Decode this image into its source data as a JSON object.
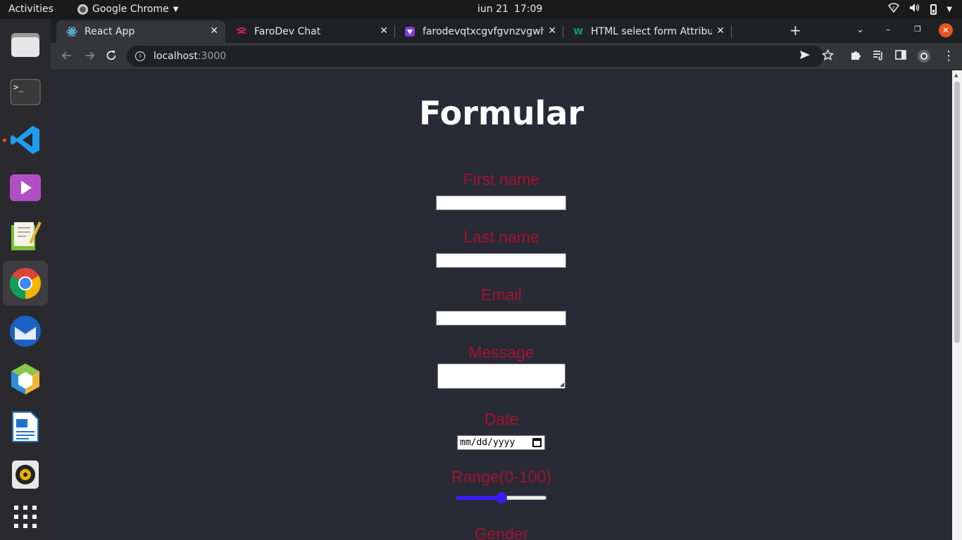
{
  "system": {
    "activities": "Activities",
    "app_name": "Google Chrome",
    "date": "iun 21",
    "time": "17:09"
  },
  "dock": {
    "items": [
      {
        "name": "files",
        "icon": "folder-icon"
      },
      {
        "name": "terminal",
        "icon": "terminal-icon"
      },
      {
        "name": "vscode",
        "icon": "vscode-icon"
      },
      {
        "name": "video",
        "icon": "play-icon"
      },
      {
        "name": "text-editor",
        "icon": "notepad-icon"
      },
      {
        "name": "chrome",
        "icon": "chrome-icon"
      },
      {
        "name": "thunderbird",
        "icon": "mail-icon"
      },
      {
        "name": "virtualbox",
        "icon": "cube-icon"
      },
      {
        "name": "writer",
        "icon": "document-icon"
      },
      {
        "name": "rhythmbox",
        "icon": "speaker-icon"
      },
      {
        "name": "app-grid",
        "icon": "grid-icon"
      }
    ]
  },
  "browser": {
    "tabs": [
      {
        "title": "React App",
        "active": true
      },
      {
        "title": "FaroDev Chat",
        "active": false
      },
      {
        "title": "farodevqtxcgvfgvnzvgwh",
        "active": false
      },
      {
        "title": "HTML select form Attribu",
        "active": false
      }
    ],
    "url_host": "localhost",
    "url_port": ":3000"
  },
  "form": {
    "title": "Formular",
    "first_name_label": "First name",
    "last_name_label": "Last name",
    "email_label": "Email",
    "message_label": "Message",
    "date_label": "Date",
    "date_placeholder": "mm/dd/yyyy",
    "range_label": "Range(0-100)",
    "range_value": 50,
    "range_min": 0,
    "range_max": 100,
    "gender_label": "Gender"
  },
  "colors": {
    "page_background": "#282a35",
    "label_color": "#a0142e",
    "title_color": "#ffffff",
    "accent": "#3a1cf2"
  }
}
